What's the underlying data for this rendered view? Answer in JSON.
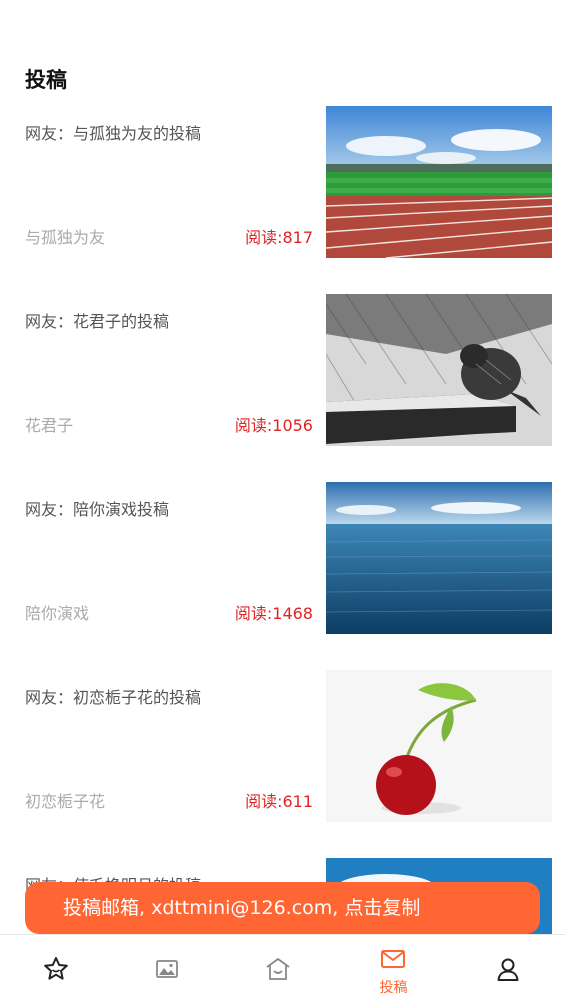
{
  "header": {
    "title": "投稿"
  },
  "articles": [
    {
      "title": "网友：与孤独为友的投稿",
      "author": "与孤独为友",
      "reads": "阅读:817",
      "image": "running-track-field"
    },
    {
      "title": "网友：花君子的投稿",
      "author": "花君子",
      "reads": "阅读:1056",
      "image": "bird-in-rain-sketch"
    },
    {
      "title": "网友：陪你演戏投稿",
      "author": "陪你演戏",
      "reads": "阅读:1468",
      "image": "ocean-horizon"
    },
    {
      "title": "网友：初恋栀子花的投稿",
      "author": "初恋栀子花",
      "reads": "阅读:611",
      "image": "cherry"
    },
    {
      "title": "网友：使毛换明月的投稿",
      "author": "",
      "reads": "",
      "image": "blue-sky-clouds"
    }
  ],
  "toast": {
    "text": "投稿邮箱, xdttmini@126.com, 点击复制"
  },
  "tabbar": {
    "items": [
      {
        "icon": "star-icon",
        "label": ""
      },
      {
        "icon": "image-icon",
        "label": ""
      },
      {
        "icon": "home-icon",
        "label": ""
      },
      {
        "icon": "mail-icon",
        "label": "投稿",
        "active": true
      },
      {
        "icon": "user-icon",
        "label": ""
      }
    ]
  },
  "colors": {
    "accent": "#ff6633",
    "reads": "#e02424",
    "muted": "#aaaaaa"
  }
}
